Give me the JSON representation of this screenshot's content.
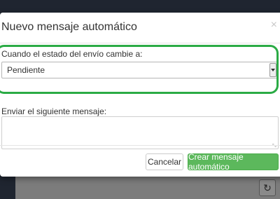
{
  "modal": {
    "title": "Nuevo mensaje automático",
    "close_label": "×"
  },
  "form": {
    "status_label": "Cuando el estado del envío cambie a:",
    "status_selected": "Pendiente",
    "message_label": "Enviar el siguiente mensaje:",
    "message_value": ""
  },
  "footer": {
    "cancel_label": "Cancelar",
    "create_label": "Crear mensaje automático"
  },
  "icons": {
    "select_arrow": "chevron-down-icon",
    "background_refresh": "refresh-icon"
  },
  "colors": {
    "highlight": "#2bab45",
    "primary_button": "#5cb85c"
  }
}
